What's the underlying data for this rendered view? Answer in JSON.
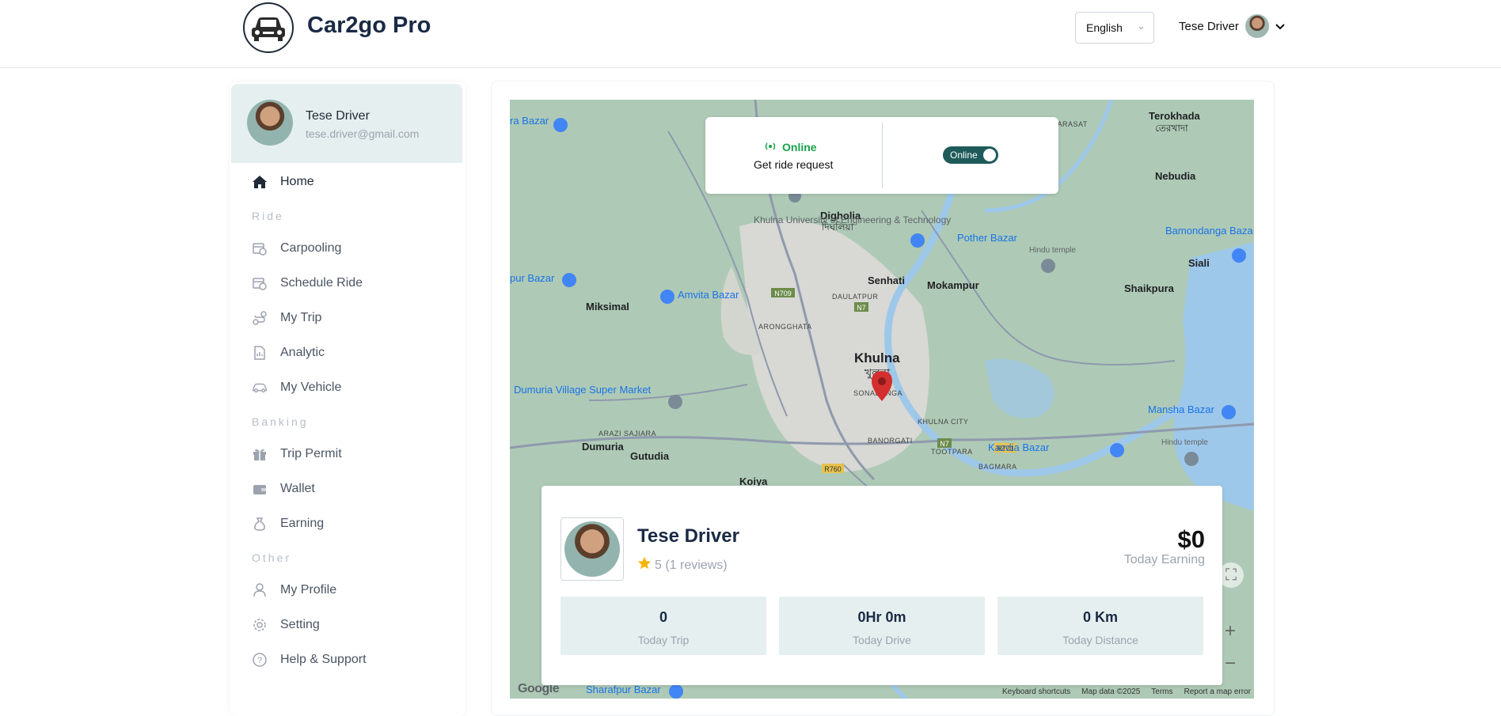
{
  "header": {
    "brand": "Car2go Pro",
    "language": "English",
    "user_name": "Tese Driver"
  },
  "sidebar": {
    "profile": {
      "name": "Tese Driver",
      "email": "tese.driver@gmail.com"
    },
    "home_label": "Home",
    "section_ride": "Ride",
    "section_banking": "Banking",
    "section_other": "Other",
    "items": {
      "carpooling": "Carpooling",
      "schedule_ride": "Schedule Ride",
      "my_trip": "My Trip",
      "analytic": "Analytic",
      "my_vehicle": "My Vehicle",
      "trip_permit": "Trip Permit",
      "wallet": "Wallet",
      "earning": "Earning",
      "my_profile": "My Profile",
      "setting": "Setting",
      "help_support": "Help & Support"
    }
  },
  "status": {
    "label": "Online",
    "sub": "Get ride request",
    "toggle_label": "Online"
  },
  "driver": {
    "name": "Tese Driver",
    "rating": "5 (1 reviews)",
    "earning_amount": "$0",
    "earning_label": "Today Earning",
    "stats": [
      {
        "value": "0",
        "label": "Today Trip"
      },
      {
        "value": "0Hr 0m",
        "label": "Today Drive"
      },
      {
        "value": "0 Km",
        "label": "Today Distance"
      }
    ]
  },
  "map": {
    "places": {
      "khulna": "Khulna",
      "khulna_bn": "খুলনা",
      "terokhada": "Terokhada",
      "terokhada_bn": "তেরখাদা",
      "nebudia": "Nebudia",
      "dighalia": "Digholia",
      "dighalia_bn": "দিঘলিয়া",
      "senhati": "Senhati",
      "mokampur": "Mokampur",
      "shaikpura": "Shaikpura",
      "siali": "Siali",
      "miksimal": "Miksimal",
      "dumuria": "Dumuria",
      "gutudia": "Gutudia",
      "koiya": "Koiya",
      "barasat": "BARASAT",
      "daulatpur": "DAULATPUR",
      "aronghata": "ARONGGHATA",
      "sonadanga": "SONADANGA",
      "khulna_city": "KHULNA CITY",
      "banorgati": "BANORGATI",
      "tootpara": "TOOTPARA",
      "bagmara": "BAGMARA",
      "arazi_sajiara": "ARAZI SAJIARA",
      "university": "Khulna University of Engineering & Technology",
      "pother_bazar": "Pother Bazar",
      "amvita_bazar": "Amvita Bazar",
      "bamondanga": "Bamondanga Baza",
      "mansha_bazar": "Mansha Bazar",
      "kazdia_bazar": "Kazdia Bazar",
      "dumuria_market": "Dumuria Village Super Market",
      "sharafpur_bazar": "Sharafpur Bazar",
      "hindu_temple": "Hindu temple",
      "ra_bazar": "ra Bazar",
      "pur_bazar": "pur Bazar",
      "n709": "N709",
      "n7": "N7",
      "r760": "R760",
      "r771": "R771"
    },
    "attribution": {
      "keyboard": "Keyboard shortcuts",
      "data": "Map data ©2025",
      "terms": "Terms",
      "report": "Report a map error"
    },
    "google": "Google"
  }
}
